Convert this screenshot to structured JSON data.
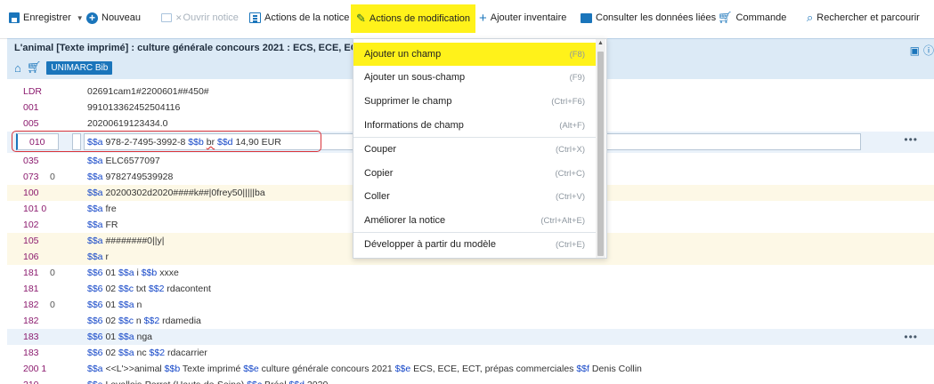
{
  "toolbar": {
    "save": "Enregistrer",
    "new": "Nouveau",
    "open": "Ouvrir notice",
    "record_actions": "Actions de la notice",
    "edit_actions": "Actions de modification",
    "add_inventory": "Ajouter inventaire",
    "linked_data": "Consulter les données liées",
    "order": "Commande",
    "search": "Rechercher et parcourir"
  },
  "header": {
    "title": "L'animal [Texte imprimé] : culture générale concours 2021 : ECS, ECE, ECT, prépas",
    "badge": "UNIMARC Bib"
  },
  "edit_row": {
    "tag": "010",
    "sf_a": "$$a",
    "v1": " 978-2-7495-3992-8 ",
    "sf_b": "$$b",
    "v2": " ",
    "br": "br",
    "v3": " ",
    "sf_d": "$$d",
    "v4": " 14,90 EUR"
  },
  "rows": [
    {
      "tag": "LDR",
      "ind": "",
      "parts": [
        {
          "t": "02691cam1#2200601##450#",
          "s": false
        }
      ]
    },
    {
      "tag": "001",
      "ind": "",
      "parts": [
        {
          "t": "991013362452504116",
          "s": false
        }
      ]
    },
    {
      "tag": "005",
      "ind": "",
      "parts": [
        {
          "t": "20200619123434.0",
          "s": false
        }
      ]
    },
    {
      "tag": "EDIT"
    },
    {
      "tag": "035",
      "ind": "",
      "parts": [
        {
          "t": "$$a",
          "s": true
        },
        {
          "t": " ELC6577097",
          "s": false
        }
      ]
    },
    {
      "tag": "073",
      "ind": "0",
      "parts": [
        {
          "t": "$$a",
          "s": true
        },
        {
          "t": " 9782749539928",
          "s": false
        }
      ]
    },
    {
      "tag": "100",
      "ind": "",
      "yellow": true,
      "parts": [
        {
          "t": "$$a",
          "s": true
        },
        {
          "t": " 20200302d2020####k##|0frey50|||||ba",
          "s": false
        }
      ]
    },
    {
      "tag": "101 0",
      "ind": "",
      "parts": [
        {
          "t": "$$a",
          "s": true
        },
        {
          "t": " fre",
          "s": false
        }
      ]
    },
    {
      "tag": "102",
      "ind": "",
      "parts": [
        {
          "t": "$$a",
          "s": true
        },
        {
          "t": " FR",
          "s": false
        }
      ]
    },
    {
      "tag": "105",
      "ind": "",
      "yellow": true,
      "parts": [
        {
          "t": "$$a",
          "s": true
        },
        {
          "t": " ########0||y|",
          "s": false
        }
      ]
    },
    {
      "tag": "106",
      "ind": "",
      "yellow": true,
      "parts": [
        {
          "t": "$$a",
          "s": true
        },
        {
          "t": " r",
          "s": false
        }
      ]
    },
    {
      "tag": "181",
      "ind": "0",
      "parts": [
        {
          "t": "$$6",
          "s": true
        },
        {
          "t": " 01 ",
          "s": false
        },
        {
          "t": "$$a",
          "s": true
        },
        {
          "t": " i ",
          "s": false
        },
        {
          "t": "$$b",
          "s": true
        },
        {
          "t": " xxxe",
          "s": false
        }
      ]
    },
    {
      "tag": "181",
      "ind": "",
      "parts": [
        {
          "t": "$$6",
          "s": true
        },
        {
          "t": " 02 ",
          "s": false
        },
        {
          "t": "$$c",
          "s": true
        },
        {
          "t": " txt ",
          "s": false
        },
        {
          "t": "$$2",
          "s": true
        },
        {
          "t": " rdacontent",
          "s": false
        }
      ]
    },
    {
      "tag": "182",
      "ind": "0",
      "parts": [
        {
          "t": "$$6",
          "s": true
        },
        {
          "t": " 01 ",
          "s": false
        },
        {
          "t": "$$a",
          "s": true
        },
        {
          "t": " n",
          "s": false
        }
      ]
    },
    {
      "tag": "182",
      "ind": "",
      "parts": [
        {
          "t": "$$6",
          "s": true
        },
        {
          "t": " 02 ",
          "s": false
        },
        {
          "t": "$$c",
          "s": true
        },
        {
          "t": " n ",
          "s": false
        },
        {
          "t": "$$2",
          "s": true
        },
        {
          "t": " rdamedia",
          "s": false
        }
      ]
    },
    {
      "tag": "183",
      "ind": "",
      "blue": true,
      "more": true,
      "parts": [
        {
          "t": "$$6",
          "s": true
        },
        {
          "t": " 01 ",
          "s": false
        },
        {
          "t": "$$a",
          "s": true
        },
        {
          "t": " nga",
          "s": false
        }
      ]
    },
    {
      "tag": "183",
      "ind": "",
      "parts": [
        {
          "t": "$$6",
          "s": true
        },
        {
          "t": " 02 ",
          "s": false
        },
        {
          "t": "$$a",
          "s": true
        },
        {
          "t": " nc ",
          "s": false
        },
        {
          "t": "$$2",
          "s": true
        },
        {
          "t": " rdacarrier",
          "s": false
        }
      ]
    },
    {
      "tag": "200 1",
      "ind": "",
      "parts": [
        {
          "t": "$$a",
          "s": true
        },
        {
          "t": " <<L'>>animal ",
          "s": false
        },
        {
          "t": "$$b",
          "s": true
        },
        {
          "t": " Texte imprimé ",
          "s": false
        },
        {
          "t": "$$e",
          "s": true
        },
        {
          "t": " culture générale concours 2021 ",
          "s": false
        },
        {
          "t": "$$e",
          "s": true
        },
        {
          "t": " ECS, ECE, ECT, prépas commerciales ",
          "s": false
        },
        {
          "t": "$$f",
          "s": true
        },
        {
          "t": " Denis Collin",
          "s": false
        }
      ]
    },
    {
      "tag": "210",
      "ind": "",
      "parts": [
        {
          "t": "$$a",
          "s": true
        },
        {
          "t": " Levallois-Perret (Hauts-de-Seine) ",
          "s": false
        },
        {
          "t": "$$c",
          "s": true
        },
        {
          "t": " Bréal ",
          "s": false
        },
        {
          "t": "$$d",
          "s": true
        },
        {
          "t": " 2020",
          "s": false
        }
      ]
    }
  ],
  "menu": {
    "items": [
      {
        "label": "Ajouter un champ",
        "shortcut": "(F8)"
      },
      {
        "label": "Ajouter un sous-champ",
        "shortcut": "(F9)"
      },
      {
        "label": "Supprimer le champ",
        "shortcut": "(Ctrl+F6)"
      },
      {
        "label": "Informations de champ",
        "shortcut": "(Alt+F)"
      },
      {
        "label": "Couper",
        "shortcut": "(Ctrl+X)"
      },
      {
        "label": "Copier",
        "shortcut": "(Ctrl+C)"
      },
      {
        "label": "Coller",
        "shortcut": "(Ctrl+V)"
      },
      {
        "label": "Améliorer la notice",
        "shortcut": "(Ctrl+Alt+E)"
      },
      {
        "label": "Développer à partir du modèle",
        "shortcut": "(Ctrl+E)"
      }
    ]
  },
  "colors": {
    "accent": "#1a75bb",
    "highlight": "#fff21a",
    "subfield": "#1547c8",
    "tag": "#8b1a6e",
    "annotation": "#d9343b"
  },
  "icons": [
    "save-icon",
    "plus-circle-icon",
    "open-record-icon",
    "record-actions-icon",
    "pencil-icon",
    "plus-icon",
    "linked-data-icon",
    "cart-icon",
    "search-icon",
    "home-icon",
    "cart-icon",
    "save-icon",
    "info-icon"
  ]
}
